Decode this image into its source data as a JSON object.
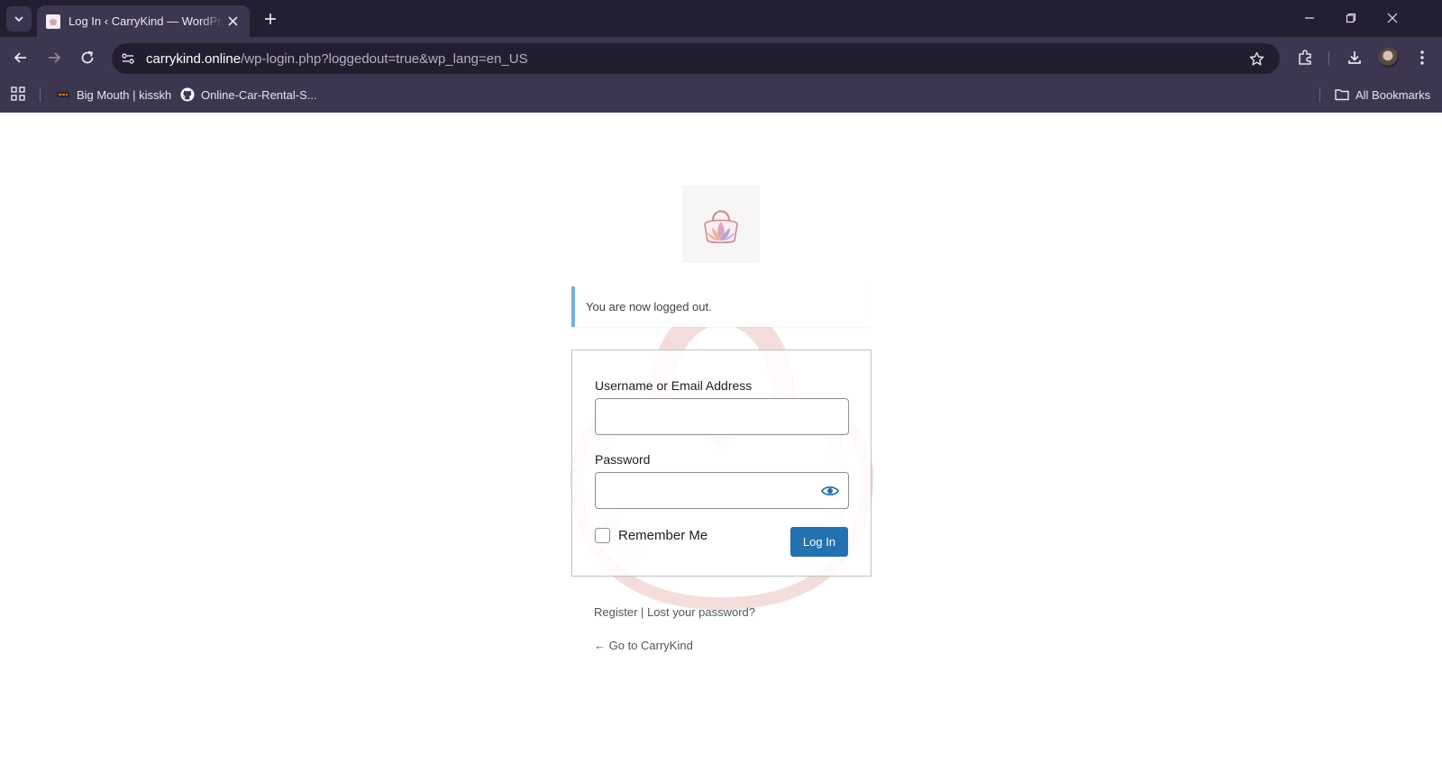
{
  "browser": {
    "tab_title": "Log In ‹ CarryKind — WordPress",
    "url_host": "carrykind.online",
    "url_path": "/wp-login.php?loggedout=true&wp_lang=en_US",
    "bookmarks": [
      {
        "label": "Big Mouth | kisskh",
        "icon": "kisskh-favicon"
      },
      {
        "label": "Online-Car-Rental-S...",
        "icon": "github-icon"
      }
    ],
    "all_bookmarks_label": "All Bookmarks"
  },
  "page": {
    "notice": "You are now logged out.",
    "form": {
      "username_label": "Username or Email Address",
      "username_value": "",
      "password_label": "Password",
      "password_value": "",
      "remember_label": "Remember Me",
      "remember_checked": false,
      "submit_label": "Log In"
    },
    "links": {
      "register": "Register",
      "separator": "|",
      "lost_password": "Lost your password?",
      "back": "← Go to CarryKind"
    }
  },
  "colors": {
    "accent": "#2271b1",
    "notice_border": "#72aee6",
    "chrome_dark": "#241e33",
    "chrome_toolbar": "#3d3650"
  }
}
